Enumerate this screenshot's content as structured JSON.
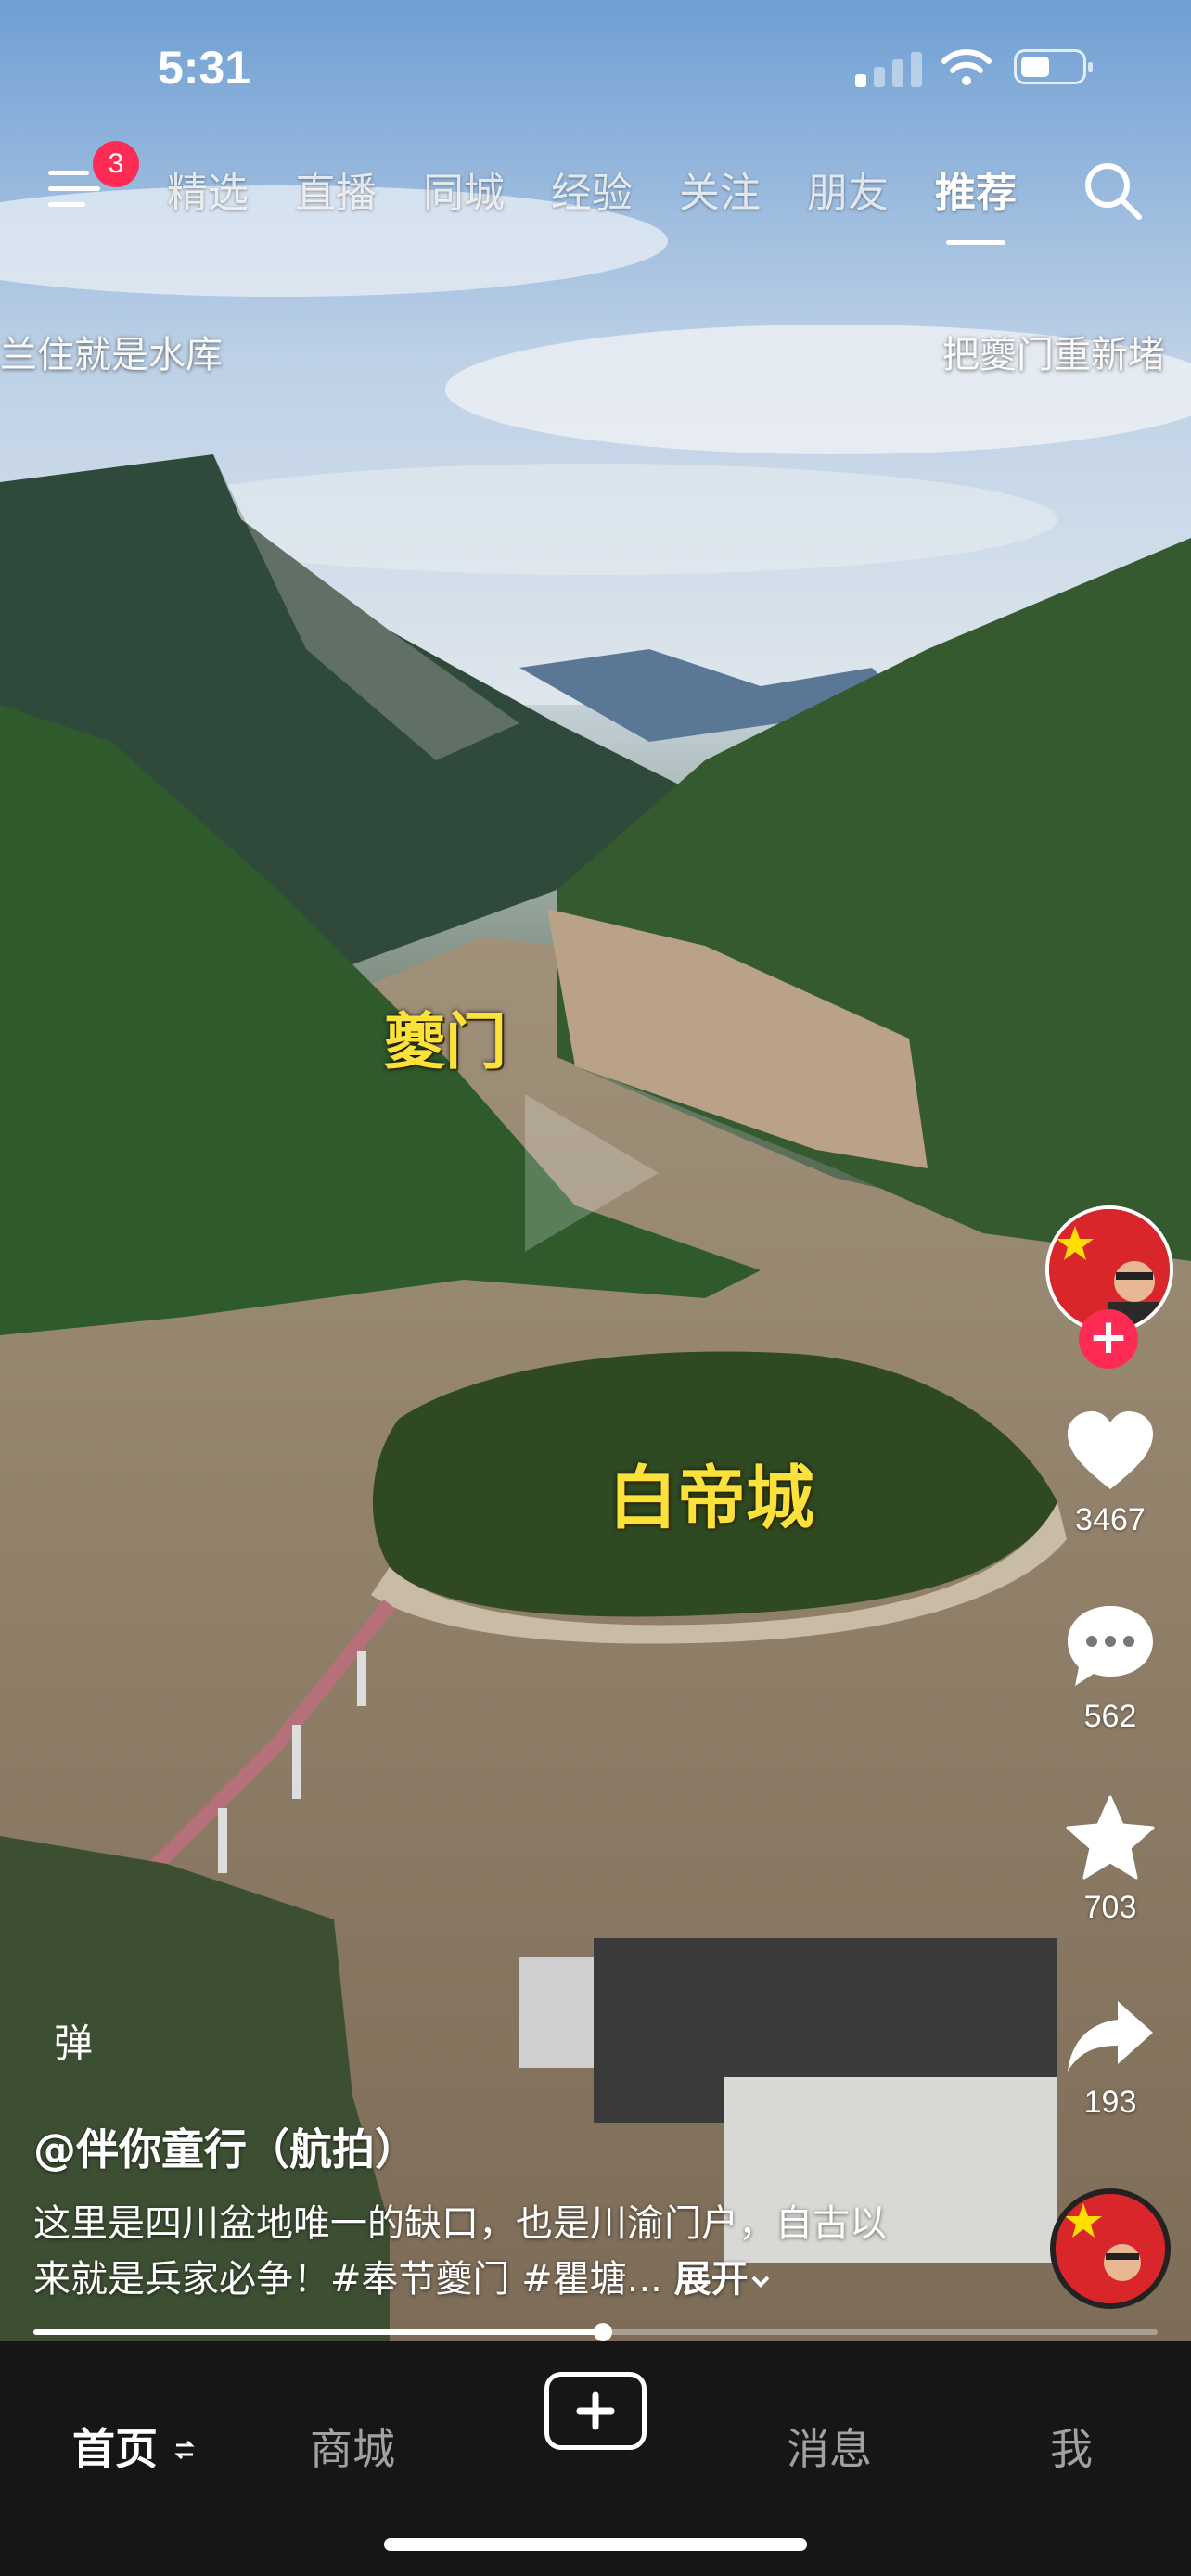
{
  "status_bar": {
    "time": "5:31",
    "battery_level": 0.45,
    "signal_bars": 1
  },
  "top_nav": {
    "notification_count": "3",
    "tabs": [
      "精选",
      "直播",
      "同城",
      "经验",
      "关注",
      "朋友",
      "推荐"
    ],
    "active_tab": "推荐"
  },
  "ticker": {
    "left": "兰住就是水库",
    "right": "把夔门重新堵"
  },
  "video_labels": {
    "gate": "夔门",
    "city": "白帝城"
  },
  "actions": {
    "likes": "3467",
    "comments": "562",
    "favorites": "703",
    "shares": "193",
    "follow": "+"
  },
  "danmaku_label": "弹",
  "post": {
    "author": "@伴你童行（航拍）",
    "caption": "这里是四川盆地唯一的缺口，也是川渝门户，自古以来就是兵家必争！#奉节夔门 #瞿塘...",
    "expand_label": "展开"
  },
  "playback": {
    "progress": 0.507
  },
  "bottom_nav": {
    "home": "首页",
    "mall": "商城",
    "messages": "消息",
    "me": "我"
  },
  "colors": {
    "accent": "#fe2c55",
    "label_yellow": "#fbe23a",
    "bar_bg": "#161616"
  },
  "icons": [
    "menu-icon",
    "search-icon",
    "heart-icon",
    "comment-icon",
    "star-icon",
    "share-icon",
    "plus-icon",
    "refresh-icon",
    "chevron-down-icon"
  ]
}
